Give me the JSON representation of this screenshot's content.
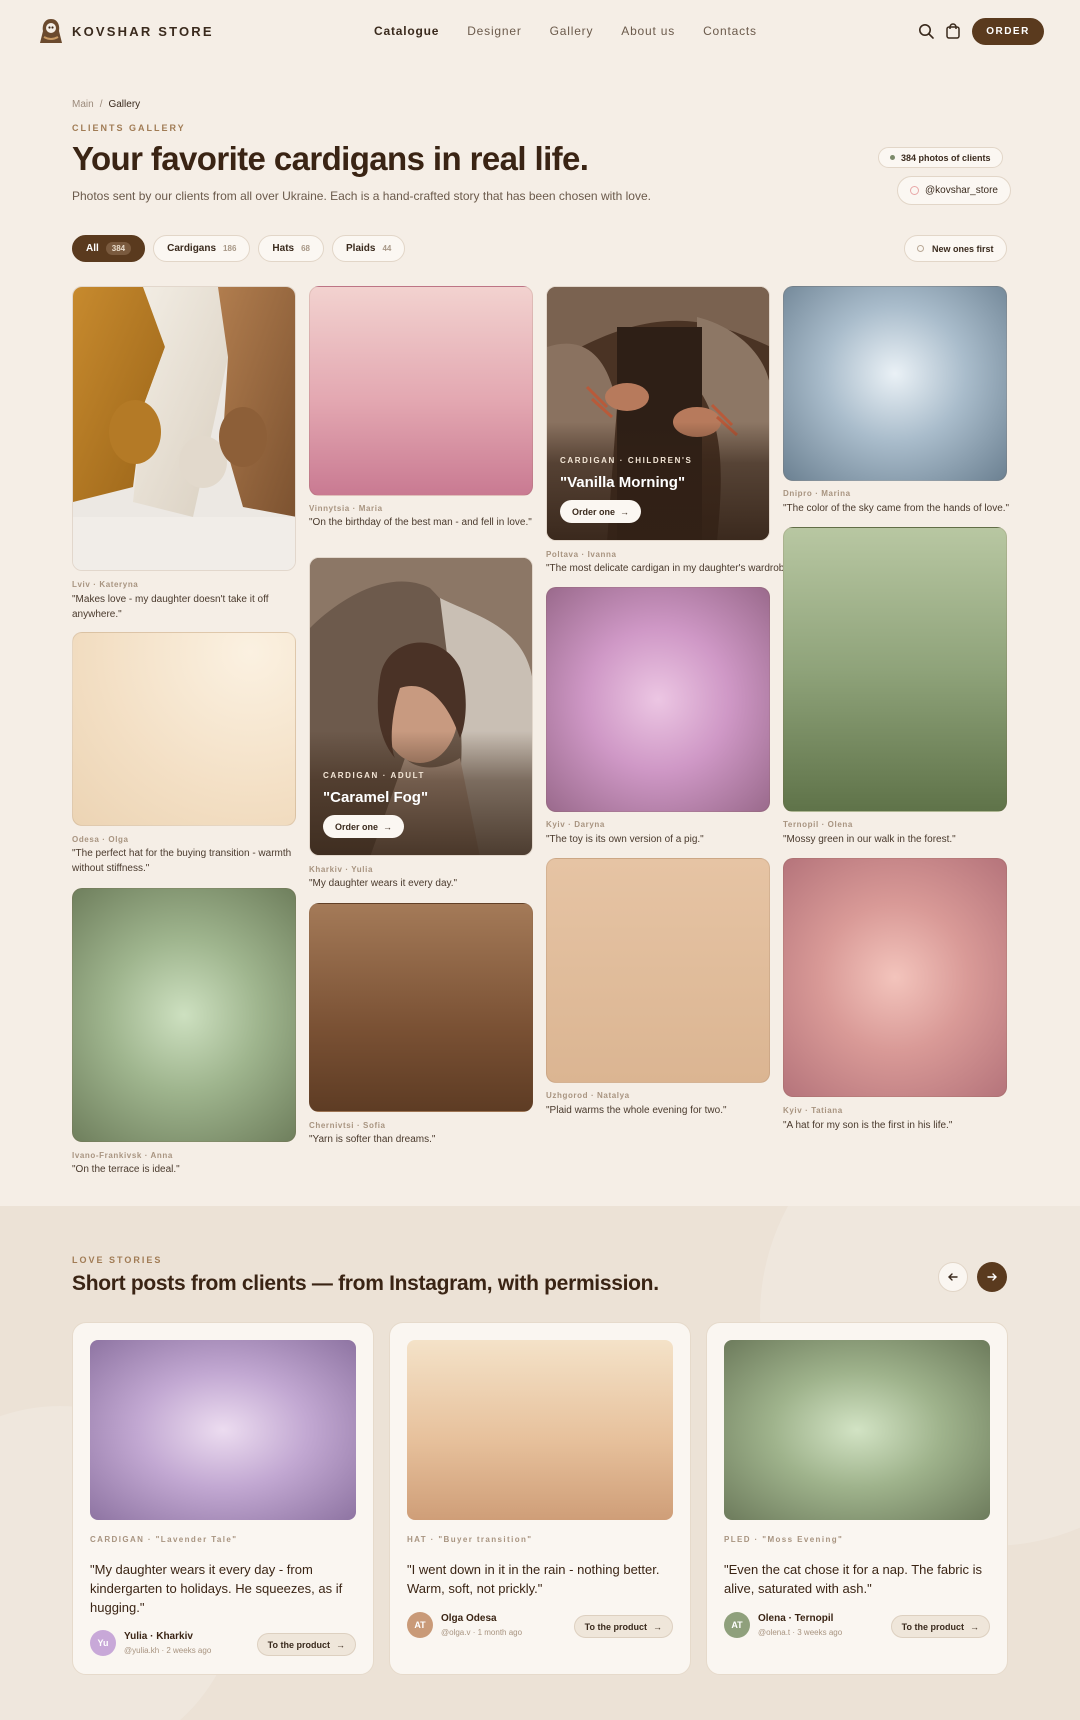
{
  "brand": {
    "name": "KOVSHAR STORE"
  },
  "nav": {
    "items": [
      "Catalogue",
      "Designer",
      "Gallery",
      "About us",
      "Contacts"
    ],
    "active": "Catalogue"
  },
  "header": {
    "order_label": "ORDER"
  },
  "breadcrumb": {
    "home": "Main",
    "sep": "/",
    "current": "Gallery"
  },
  "hero": {
    "eyebrow": "CLIENTS GALLERY",
    "title": "Your favorite cardigans in real life.",
    "lead": "Photos sent by our clients from all over Ukraine. Each is a hand-crafted story that has been chosen with love.",
    "stat": "384 photos of clients",
    "instagram": "@kovshar_store"
  },
  "filters": [
    {
      "label": "All",
      "count": "384"
    },
    {
      "label": "Cardigans",
      "count": "186"
    },
    {
      "label": "Hats",
      "count": "68"
    },
    {
      "label": "Plaids",
      "count": "44"
    }
  ],
  "sort_label": "New ones first",
  "gallery": [
    {
      "meta": "Lviv · Kateryna",
      "quote": "\"Makes love - my daughter doesn't take it off anywhere.\""
    },
    {
      "meta": "Odesa · Olga",
      "quote": "\"The perfect hat for the buying transition - warmth without stiffness.\""
    },
    {
      "meta": "Ivano-Frankivsk · Anna",
      "quote": "\"On the terrace is ideal.\""
    },
    {
      "meta": "Vinnytsia · Maria",
      "quote": "\"On the birthday of the best man - and fell in love.\""
    },
    {
      "meta": "Kharkiv · Yulia",
      "quote": "\"My daughter wears it every day.\"",
      "tag": "CARDIGAN · ADULT",
      "title": "\"Caramel Fog\"",
      "btn": "Order one"
    },
    {
      "meta": "Chernivtsi · Sofia",
      "quote": "\"Yarn is softer than dreams.\""
    },
    {
      "meta": "Poltava · Ivanna",
      "quote": "\"The most delicate cardigan in my daughter's wardrobe.\"",
      "tag": "CARDIGAN · CHILDREN'S",
      "title": "\"Vanilla Morning\"",
      "btn": "Order one"
    },
    {
      "meta": "Kyiv · Daryna",
      "quote": "\"The toy is its own version of a pig.\""
    },
    {
      "meta": "Uzhgorod · Natalya",
      "quote": "\"Plaid warms the whole evening for two.\""
    },
    {
      "meta": "Dnipro · Marina",
      "quote": "\"The color of the sky came from the hands of love.\""
    },
    {
      "meta": "Ternopil · Olena",
      "quote": "\"Mossy green in our walk in the forest.\""
    },
    {
      "meta": "Kyiv · Tatiana",
      "quote": "\"A hat for my son is the first in his life.\""
    }
  ],
  "stories": {
    "eyebrow": "LOVE STORIES",
    "title": "Short posts from clients — from Instagram, with permission.",
    "cards": [
      {
        "tag": "CARDIGAN · \"Lavender Tale\"",
        "quote": "\"My daughter wears it every day - from kindergarten to holidays. He squeezes, as if hugging.\"",
        "initials": "Yu",
        "author": "Yulia · Kharkiv",
        "handle": "@yulia.kh · 2 weeks ago",
        "btn": "To the product"
      },
      {
        "tag": "HAT · \"Buyer transition\"",
        "quote": "\"I went down in it in the rain - nothing better. Warm, soft, not prickly.\"",
        "initials": "AT",
        "author": "Olga Odesa",
        "handle": "@olga.v · 1 month ago",
        "btn": "To the product"
      },
      {
        "tag": "PLED · \"Moss Evening\"",
        "quote": "\"Even the cat chose it for a nap. The fabric is alive, saturated with ash.\"",
        "initials": "AT",
        "author": "Olena · Ternopil",
        "handle": "@olena.t · 3 weeks ago",
        "btn": "To the product"
      }
    ]
  },
  "colors": {
    "bg": "#f5eee6",
    "accent": "#5a3a1e",
    "stories_bg": "#ece2d6"
  },
  "icons": {
    "search": "search-icon",
    "cart": "cart-icon",
    "prev": "arrow-left-icon",
    "next": "arrow-right-icon"
  }
}
